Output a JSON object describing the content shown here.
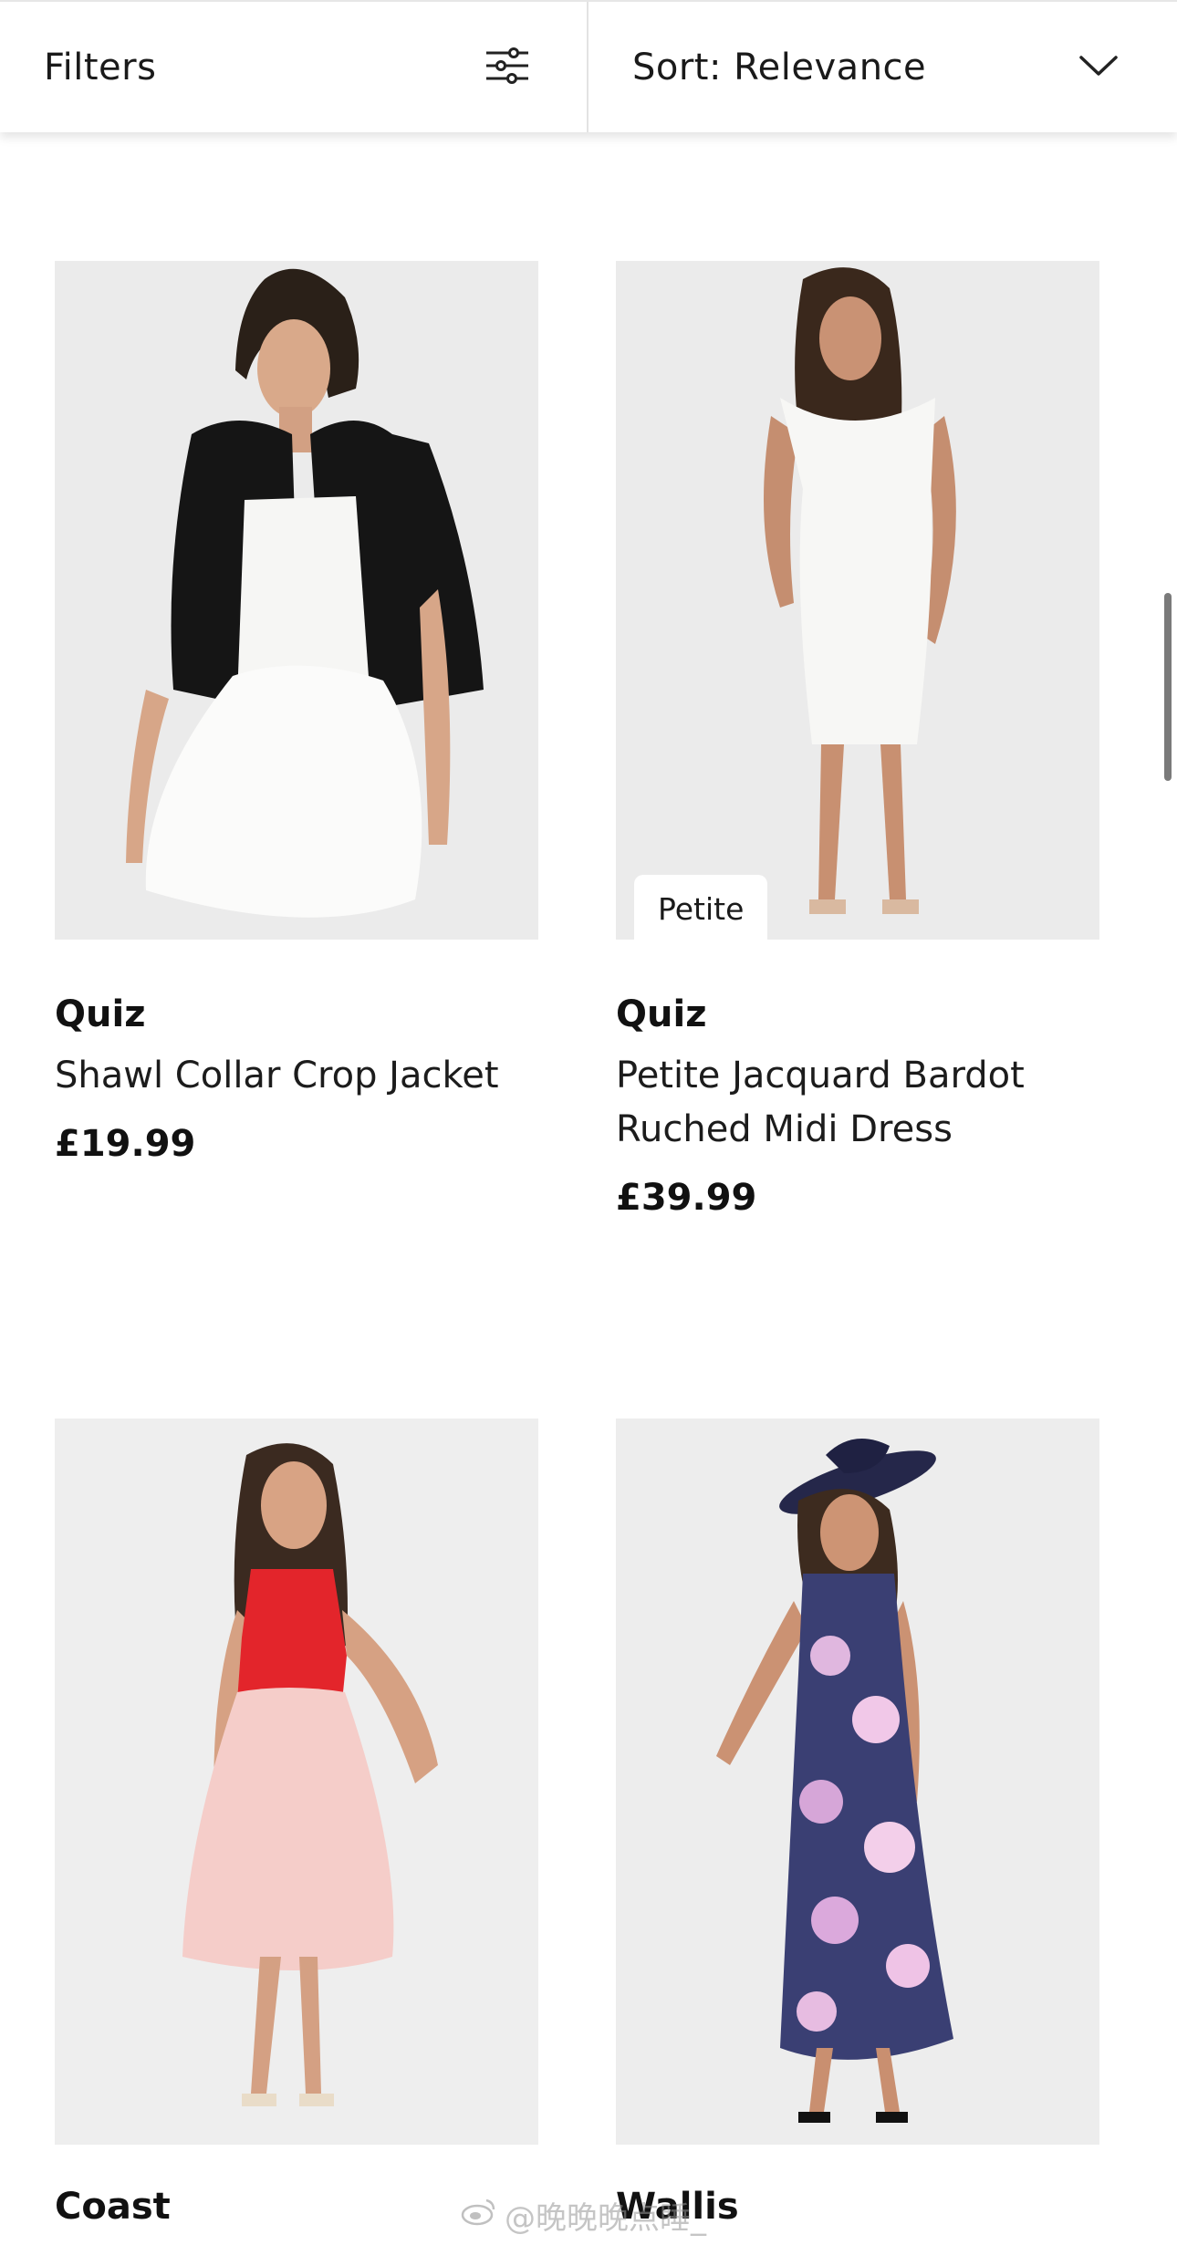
{
  "toolbar": {
    "filters_label": "Filters",
    "sort_label": "Sort: Relevance"
  },
  "products": [
    {
      "brand": "Quiz",
      "name": "Shawl Collar Crop Jacket",
      "price": "£19.99",
      "badge": ""
    },
    {
      "brand": "Quiz",
      "name": "Petite Jacquard Bardot Ruched Midi Dress",
      "price": "£39.99",
      "badge": "Petite"
    },
    {
      "brand": "Coast",
      "name": "",
      "price": "",
      "badge": ""
    },
    {
      "brand": "Wallis",
      "name": "",
      "price": "",
      "badge": ""
    }
  ],
  "watermark": {
    "text": "@晚晚晚点睡_"
  },
  "icons": {
    "filters": "sliders-icon",
    "sort": "chevron-down-icon"
  }
}
